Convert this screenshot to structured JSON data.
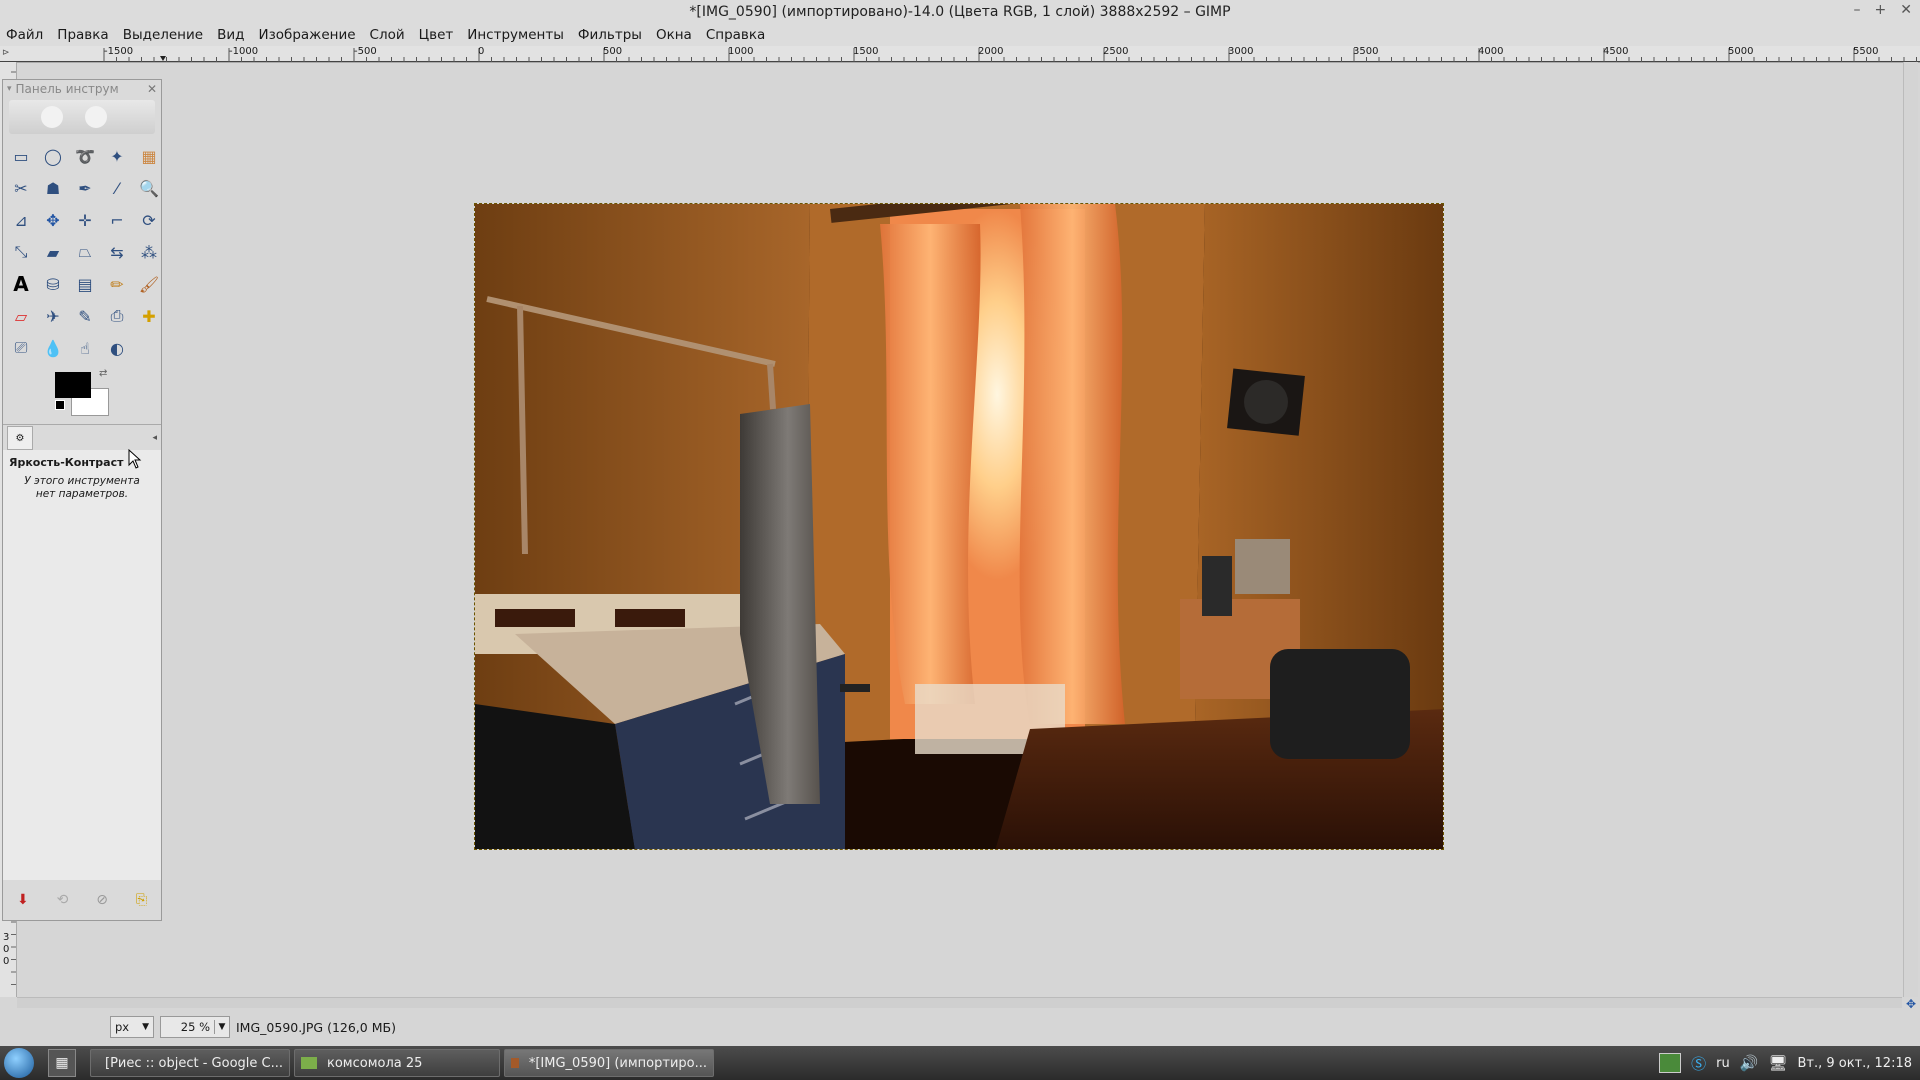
{
  "window": {
    "title": "*[IMG_0590] (импортировано)-14.0 (Цвета RGB, 1 слой) 3888x2592 – GIMP",
    "minimize": "–",
    "maximize": "+",
    "close": "✕"
  },
  "menu": [
    "Файл",
    "Правка",
    "Выделение",
    "Вид",
    "Изображение",
    "Слой",
    "Цвет",
    "Инструменты",
    "Фильтры",
    "Окна",
    "Справка"
  ],
  "ruler": {
    "h_ticks": [
      "-1500",
      "-1000",
      "-500",
      "0",
      "500",
      "1000",
      "1500",
      "2000",
      "2500",
      "3000",
      "3500",
      "4000",
      "4500",
      "5000",
      "5500"
    ],
    "v_ticks": [
      "3",
      "0",
      "0"
    ]
  },
  "toolbox": {
    "title": "Панель инструм",
    "close": "✕",
    "options_title": "Яркость-Контраст",
    "options_text_1": "У этого инструмента",
    "options_text_2": "нет параметров.",
    "tools": [
      "rect-select",
      "ellipse-select",
      "free-select",
      "fuzzy-select",
      "color-select",
      "scissors-select",
      "foreground-select",
      "paths",
      "color-picker",
      "zoom",
      "measure",
      "move",
      "align",
      "crop",
      "rotate",
      "scale",
      "shear",
      "perspective",
      "flip",
      "cage",
      "text",
      "bucket-fill",
      "blend",
      "pencil",
      "paintbrush",
      "eraser",
      "airbrush",
      "ink",
      "clone",
      "heal",
      "perspective-clone",
      "blur",
      "smudge",
      "dodge-burn"
    ]
  },
  "colors": {
    "foreground": "#000000",
    "background": "#ffffff"
  },
  "status": {
    "unit": "px",
    "zoom": "25 %",
    "file_info": "IMG_0590.JPG (126,0 МБ)"
  },
  "taskbar": {
    "tasks": [
      {
        "label": "[Риес :: object - Google C...",
        "icon": "chrome-icon"
      },
      {
        "label": "комсомола 25",
        "icon": "folder-icon"
      },
      {
        "label": "*[IMG_0590] (импортиро...",
        "icon": "gimp-icon"
      }
    ],
    "lang": "ru",
    "clock": "Вт., 9 окт., 12:18"
  }
}
